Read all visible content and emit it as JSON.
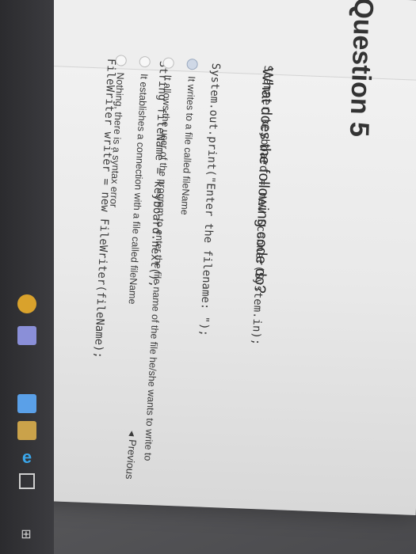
{
  "header": {
    "title": "Question 5"
  },
  "question": {
    "prompt": "What does the following code do?",
    "code_lines": [
      "Scanner keyboard = new Scanner(System.in);",
      "System.out.print(\"Enter the filename: \");",
      "String fileName = keyboard.next();",
      "FileWriter writer = new FileWriter(fileName);"
    ],
    "options": [
      "It writes to a file called fileName",
      "It allows the user of the program to enter the file name of the file he/she wants to write to",
      "It establishes a connection with a file called fileName",
      "Nothing, there is a syntax error"
    ]
  },
  "navigation": {
    "previous_label": "Previous"
  },
  "taskbar": {
    "icons": [
      "windows-icon",
      "task-view-icon",
      "edge-icon",
      "mail-icon",
      "store-icon",
      "pencil-icon",
      "chrome-icon"
    ]
  }
}
